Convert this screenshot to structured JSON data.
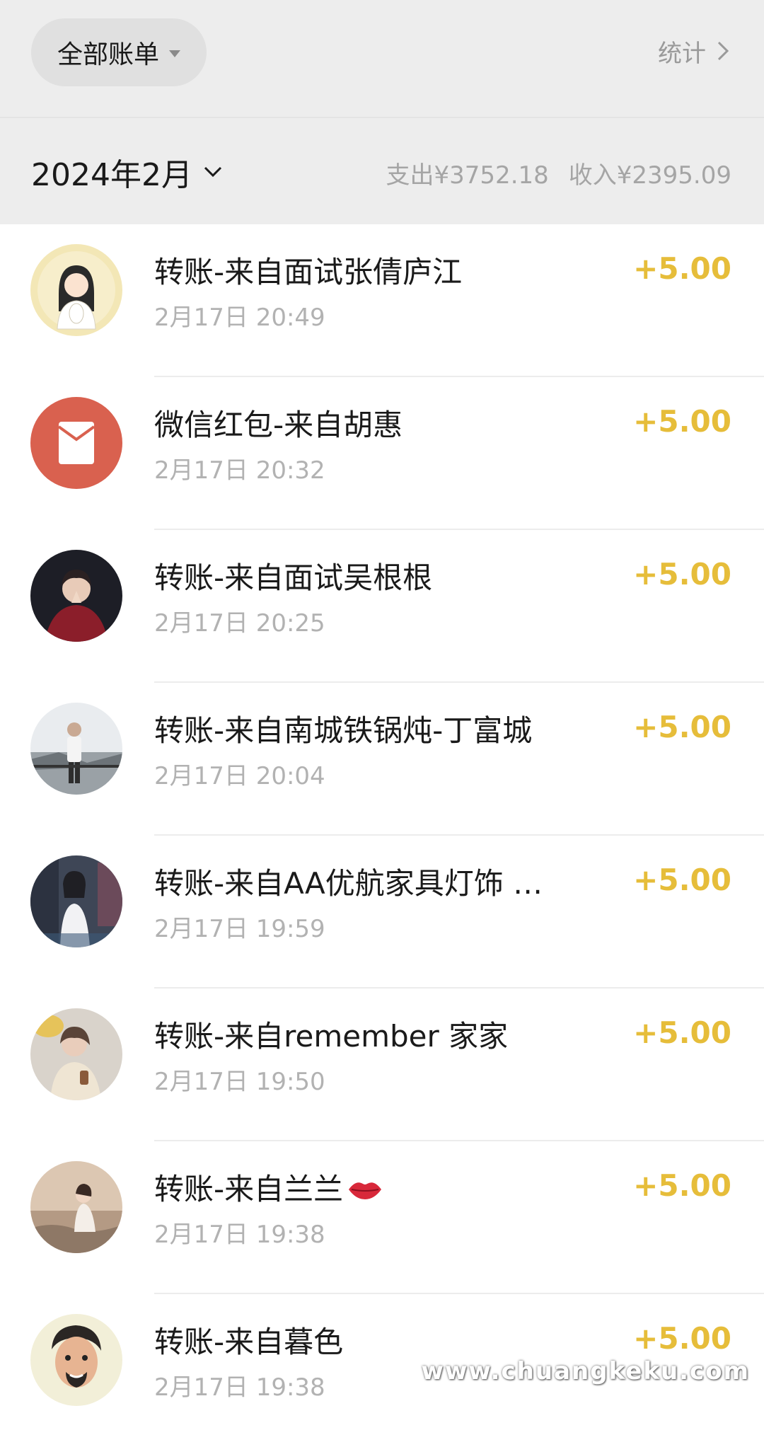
{
  "header": {
    "filter_label": "全部账单",
    "stats_label": "统计"
  },
  "month_bar": {
    "month_label": "2024年2月",
    "expense_label": "支出¥3752.18",
    "income_label": "收入¥2395.09"
  },
  "colors": {
    "background": "#ededed",
    "income_amount": "#e6bd3a",
    "secondary_text": "#b2b2b2",
    "red_packet": "#d9614f"
  },
  "transactions": [
    {
      "title": "转账-来自面试张倩庐江",
      "time": "2月17日 20:49",
      "amount": "+5.00",
      "avatar": "avatar-illustration-girl"
    },
    {
      "title": "微信红包-来自胡惠",
      "time": "2月17日 20:32",
      "amount": "+5.00",
      "avatar": "red-packet-icon"
    },
    {
      "title": "转账-来自面试吴根根",
      "time": "2月17日 20:25",
      "amount": "+5.00",
      "avatar": "avatar-photo"
    },
    {
      "title": "转账-来自南城铁锅炖-丁富城",
      "time": "2月17日 20:04",
      "amount": "+5.00",
      "avatar": "avatar-photo"
    },
    {
      "title": "转账-来自AA优航家具灯饰 …",
      "time": "2月17日 19:59",
      "amount": "+5.00",
      "avatar": "avatar-photo"
    },
    {
      "title": "转账-来自remember 家家",
      "time": "2月17日 19:50",
      "amount": "+5.00",
      "avatar": "avatar-photo"
    },
    {
      "title": "转账-来自兰兰",
      "time": "2月17日 19:38",
      "amount": "+5.00",
      "avatar": "avatar-photo",
      "title_icon": "lips-icon"
    },
    {
      "title": "转账-来自暮色",
      "time": "2月17日 19:38",
      "amount": "+5.00",
      "avatar": "avatar-cartoon-man"
    }
  ],
  "watermark": "www.chuangkeku.com"
}
